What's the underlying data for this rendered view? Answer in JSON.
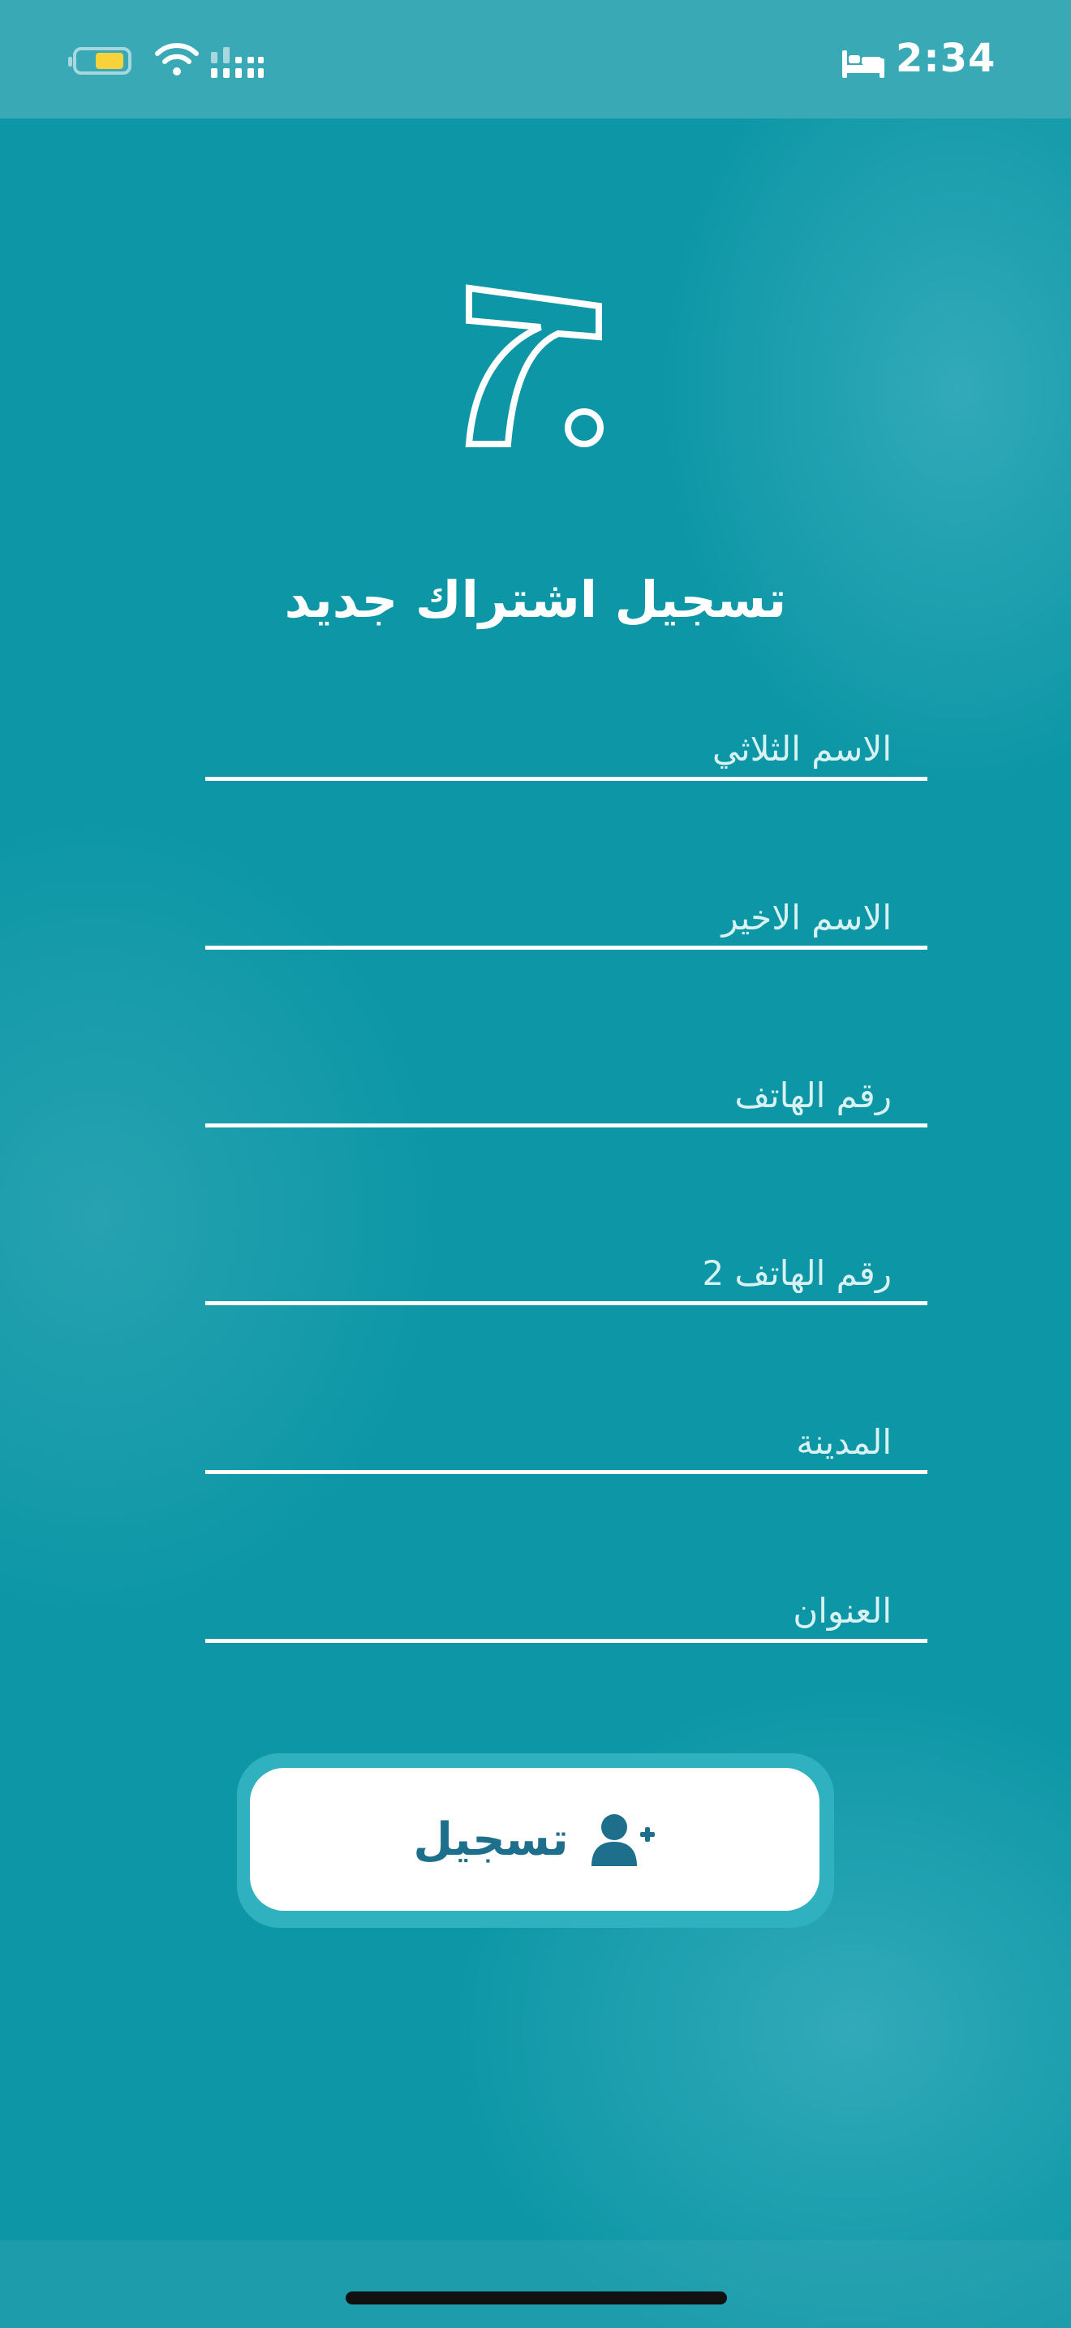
{
  "status_bar": {
    "time": "2:34",
    "battery_level": 0.4,
    "icons": [
      "battery-icon",
      "wifi-icon",
      "cellular-signal-icon",
      "sleep-focus-icon"
    ]
  },
  "logo": {
    "icon": "brand-logo-icon"
  },
  "page": {
    "title": "تسجيل اشتراك جديد"
  },
  "form": {
    "full_name_placeholder": "الاسم الثلاثي",
    "last_name_placeholder": "الاسم الاخير",
    "phone_placeholder": "رقم الهاتف",
    "phone2_placeholder": "رقم الهاتف 2",
    "city_placeholder": "المدينة",
    "address_placeholder": "العنوان"
  },
  "register_button": {
    "label": "تسجيل",
    "icon": "add-user-icon"
  },
  "colors": {
    "background": "#0d97a6",
    "status_bar": "#3aa9b6",
    "button_text": "#1e6f8c",
    "button_ring": "#2fb1c0",
    "battery_fill": "#f7d23a"
  }
}
